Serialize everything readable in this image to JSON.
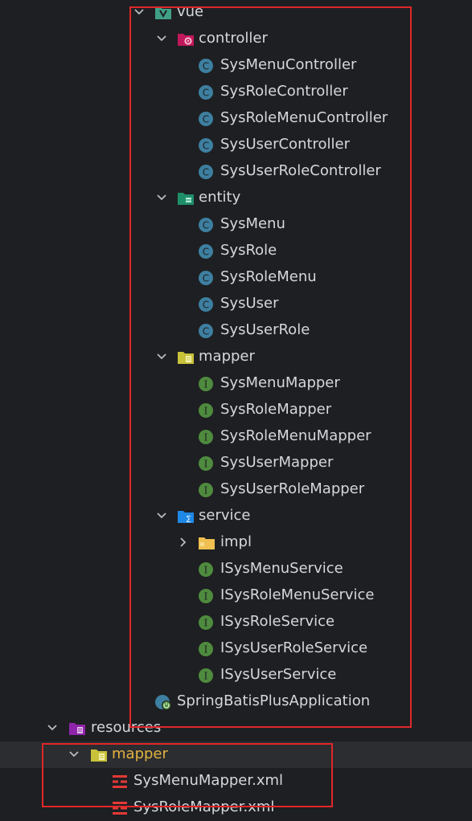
{
  "tree": {
    "vue": "vue",
    "controller": {
      "label": "controller",
      "items": [
        "SysMenuController",
        "SysRoleController",
        "SysRoleMenuController",
        "SysUserController",
        "SysUserRoleController"
      ]
    },
    "entity": {
      "label": "entity",
      "items": [
        "SysMenu",
        "SysRole",
        "SysRoleMenu",
        "SysUser",
        "SysUserRole"
      ]
    },
    "mapper": {
      "label": "mapper",
      "items": [
        "SysMenuMapper",
        "SysRoleMapper",
        "SysRoleMenuMapper",
        "SysUserMapper",
        "SysUserRoleMapper"
      ]
    },
    "service": {
      "label": "service",
      "impl": "impl",
      "items": [
        "ISysMenuService",
        "ISysRoleMenuService",
        "ISysRoleService",
        "ISysUserRoleService",
        "ISysUserService"
      ]
    },
    "application": "SpringBatisPlusApplication",
    "resources": "resources",
    "resources_mapper": {
      "label": "mapper",
      "items": [
        "SysMenuMapper.xml",
        "SysRoleMapper.xml"
      ]
    }
  },
  "colors": {
    "highlight_box": "#e0272a",
    "class_icon": "#3d7fa0",
    "interface_icon": "#4e8b3e",
    "folder_yellow": "#c8c23a",
    "selected_row": "#2b2d30",
    "selected_text": "#e3b341"
  }
}
